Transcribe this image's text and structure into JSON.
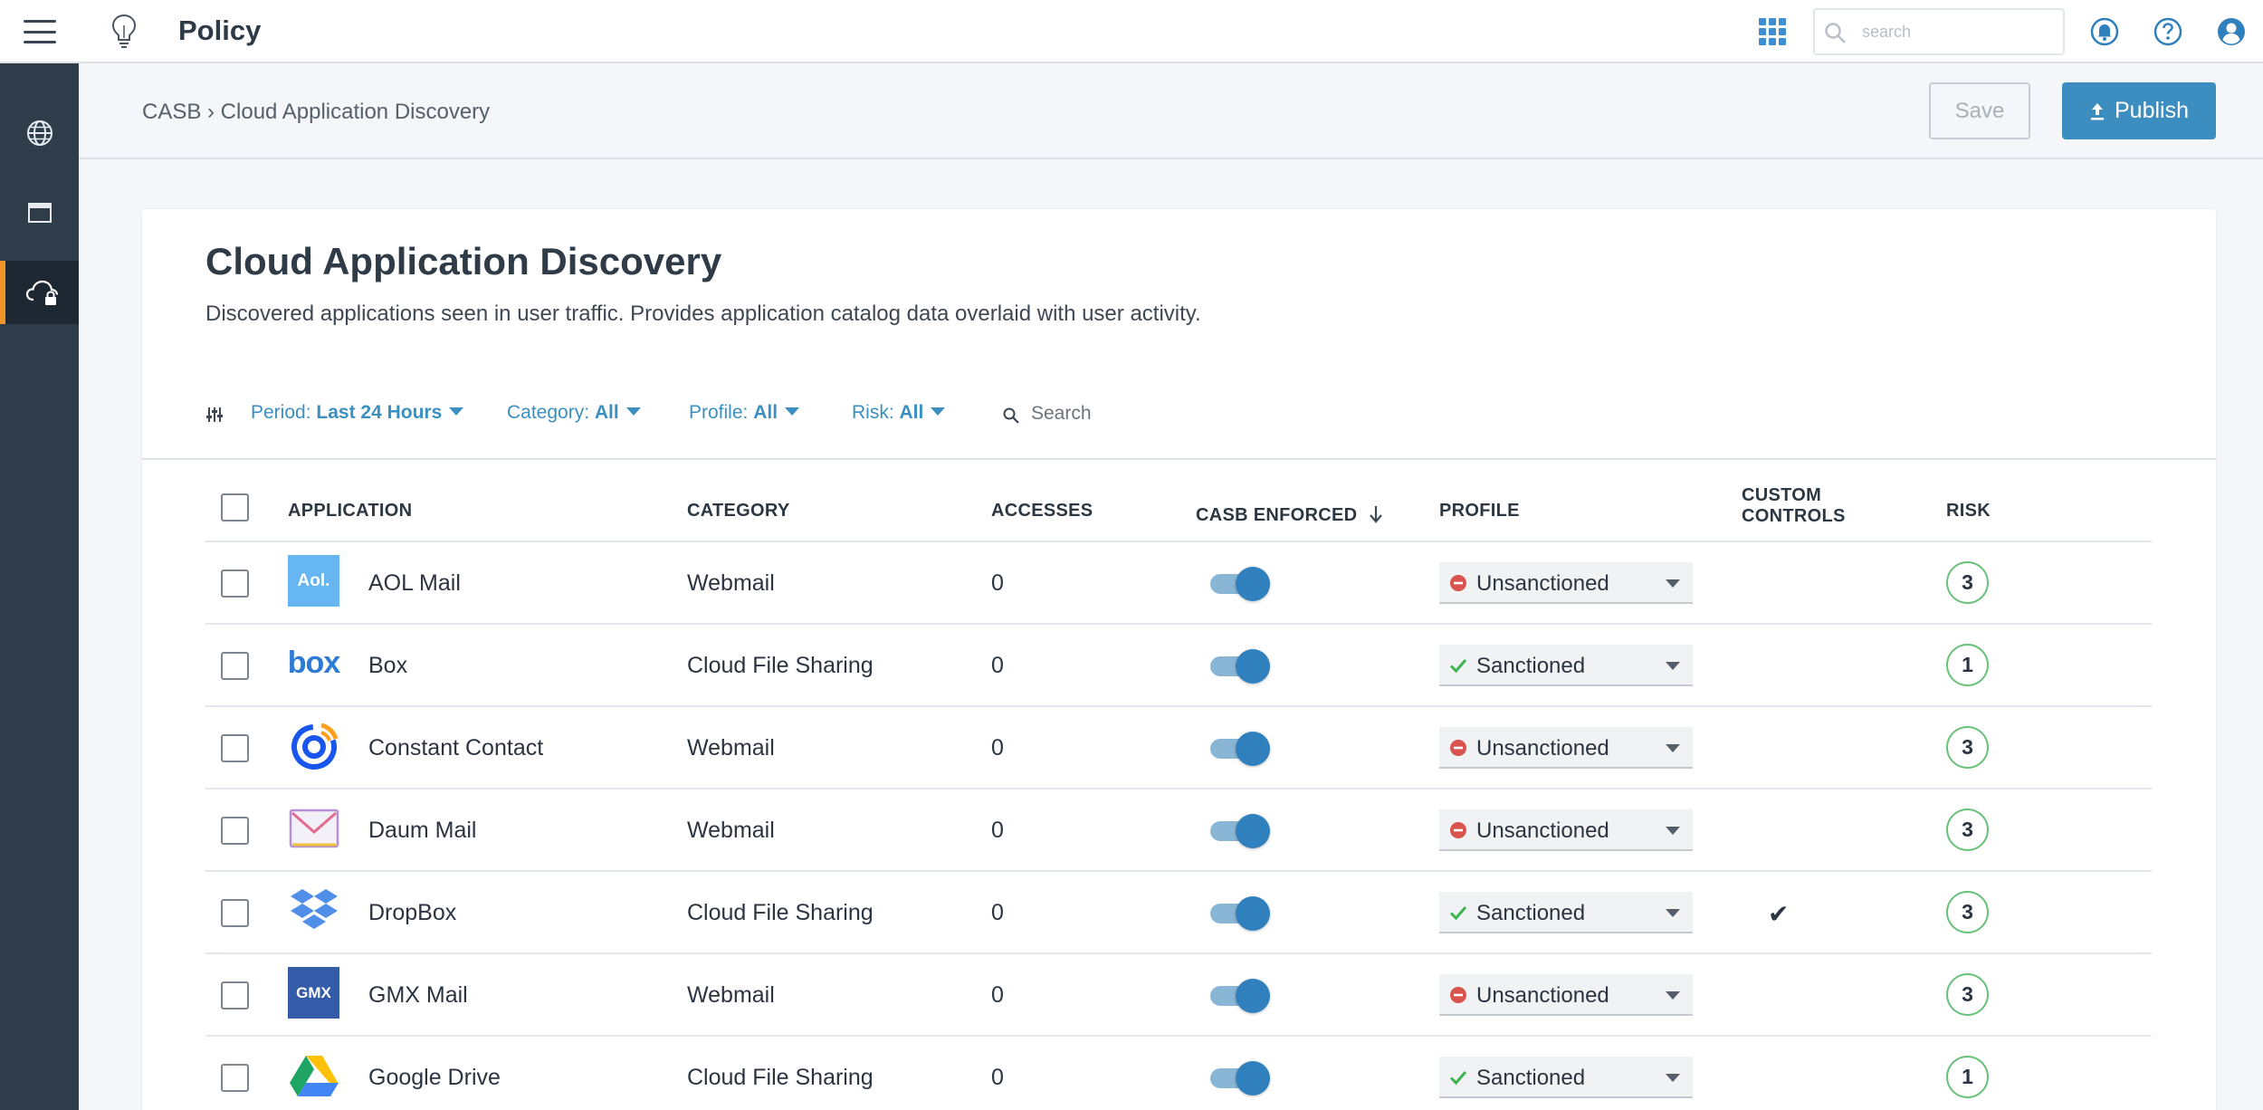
{
  "app": {
    "title": "Policy"
  },
  "topbar": {
    "search_placeholder": "search",
    "icons": [
      "menu-icon",
      "lightbulb-icon",
      "apps-grid-icon",
      "search-icon",
      "notification-icon",
      "help-icon",
      "user-icon"
    ]
  },
  "leftnav": {
    "items": [
      {
        "icon": "globe-icon"
      },
      {
        "icon": "window-icon"
      },
      {
        "icon": "cloud-lock-icon",
        "active": true
      }
    ]
  },
  "breadcrumb": {
    "text": "CASB › Cloud Application Discovery"
  },
  "actions": {
    "save_label": "Save",
    "publish_label": "Publish"
  },
  "page": {
    "title": "Cloud Application Discovery",
    "description": "Discovered applications seen in user traffic. Provides application catalog data overlaid with user activity."
  },
  "filters": {
    "period_label": "Period:",
    "period_value": "Last 24 Hours",
    "category_label": "Category:",
    "category_value": "All",
    "profile_label": "Profile:",
    "profile_value": "All",
    "risk_label": "Risk:",
    "risk_value": "All",
    "search_placeholder": "Search"
  },
  "table": {
    "headers": {
      "application": "APPLICATION",
      "category": "CATEGORY",
      "accesses": "ACCESSES",
      "casb_enforced": "CASB ENFORCED",
      "profile": "PROFILE",
      "custom_controls_1": "CUSTOM",
      "custom_controls_2": "CONTROLS",
      "risk": "RISK"
    },
    "rows": [
      {
        "name": "AOL Mail",
        "logo_text": "Aol.",
        "category": "Webmail",
        "accesses": "0",
        "enforced": true,
        "profile": "Unsanctioned",
        "custom": "",
        "risk": "3"
      },
      {
        "name": "Box",
        "logo_text": "box",
        "category": "Cloud File Sharing",
        "accesses": "0",
        "enforced": true,
        "profile": "Sanctioned",
        "custom": "",
        "risk": "1"
      },
      {
        "name": "Constant Contact",
        "logo_text": "",
        "category": "Webmail",
        "accesses": "0",
        "enforced": true,
        "profile": "Unsanctioned",
        "custom": "",
        "risk": "3"
      },
      {
        "name": "Daum Mail",
        "logo_text": "",
        "category": "Webmail",
        "accesses": "0",
        "enforced": true,
        "profile": "Unsanctioned",
        "custom": "",
        "risk": "3"
      },
      {
        "name": "DropBox",
        "logo_text": "",
        "category": "Cloud File Sharing",
        "accesses": "0",
        "enforced": true,
        "profile": "Sanctioned",
        "custom": "✔",
        "risk": "3"
      },
      {
        "name": "GMX Mail",
        "logo_text": "GMX",
        "category": "Webmail",
        "accesses": "0",
        "enforced": true,
        "profile": "Unsanctioned",
        "custom": "",
        "risk": "3"
      },
      {
        "name": "Google Drive",
        "logo_text": "",
        "category": "Cloud File Sharing",
        "accesses": "0",
        "enforced": true,
        "profile": "Sanctioned",
        "custom": "",
        "risk": "1"
      }
    ]
  },
  "colors": {
    "accent": "#3d8ec0",
    "nav_bg": "#2f3d4b",
    "nav_active_marker": "#f0942a",
    "risk_ring": "#6ac17a",
    "sanctioned": "#3cb44f",
    "unsanctioned": "#d9534f"
  }
}
